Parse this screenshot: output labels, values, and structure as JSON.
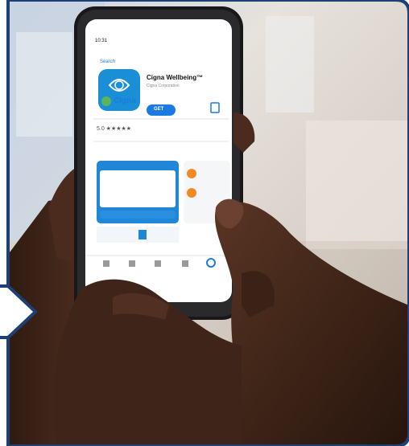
{
  "colors": {
    "frame_border": "#1d3f73",
    "background_blur": "#d8d6d1",
    "phone_body": "#1b1b1d",
    "screen_bg": "#ffffff",
    "app_icon_bg": "#1a8fd6",
    "accent_blue": "#1a7ae0",
    "cigna_green": "#5fb45a",
    "skin_dark": "#3a2317"
  },
  "phone": {
    "status_time": "10:31",
    "back_label": "Search",
    "app_name": "Cigna Wellbeing™",
    "developer": "Cigna Corporation",
    "get_button": "GET",
    "brand": "Cigna",
    "rating": "5.0 ★★★★★"
  },
  "icons": [
    "share-icon",
    "apps-tab-icon",
    "games-tab-icon",
    "arcade-tab-icon",
    "updates-tab-icon",
    "search-tab-icon"
  ]
}
